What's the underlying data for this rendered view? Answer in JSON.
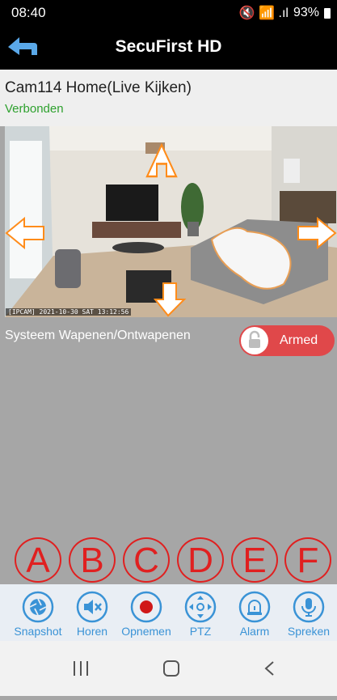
{
  "status_bar": {
    "time": "08:40",
    "indicators": "🔇 📶 .ıl",
    "battery": "93%"
  },
  "app_bar": {
    "title": "SecuFirst HD",
    "back_icon": "back-arrow-icon"
  },
  "camera": {
    "name": "Cam114 Home(Live Kijken)",
    "status": "Verbonden",
    "timestamp": "[IPCAM] 2021-10-30 SAT 13:12:56"
  },
  "arm": {
    "label": "Systeem Wapenen/Ontwapenen",
    "state": "Armed"
  },
  "annotations": [
    "A",
    "B",
    "C",
    "D",
    "E",
    "F"
  ],
  "toolbar": [
    {
      "label": "Snapshot",
      "icon": "camera-shutter-icon"
    },
    {
      "label": "Horen",
      "icon": "speaker-mute-icon"
    },
    {
      "label": "Opnemen",
      "icon": "record-icon"
    },
    {
      "label": "PTZ",
      "icon": "ptz-arrows-icon"
    },
    {
      "label": "Alarm",
      "icon": "alarm-light-icon"
    },
    {
      "label": "Spreken",
      "icon": "microphone-icon"
    }
  ],
  "colors": {
    "accent": "#3a93d6",
    "armed": "#e0484a",
    "connected": "#2ea12e",
    "annotation": "#e02020"
  }
}
